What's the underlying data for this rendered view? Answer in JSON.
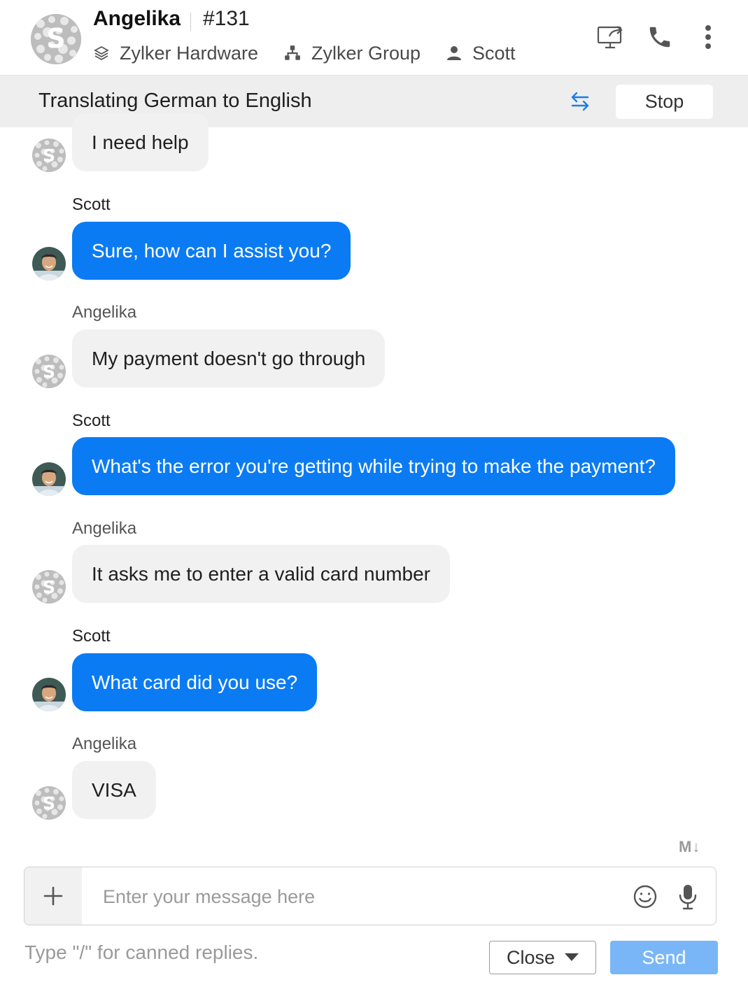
{
  "header": {
    "contact_name": "Angelika",
    "ticket_id": "#131",
    "brand": "Zylker Hardware",
    "department": "Zylker Group",
    "agent": "Scott"
  },
  "translation": {
    "label": "Translating German to English",
    "stop_label": "Stop"
  },
  "messages": [
    {
      "sender": "",
      "text": "I need help",
      "direction": "in"
    },
    {
      "sender": "Scott",
      "text": "Sure, how can I assist you?",
      "direction": "out"
    },
    {
      "sender": "Angelika",
      "text": "My payment doesn't go through",
      "direction": "in"
    },
    {
      "sender": "Scott",
      "text": "What's the error you're getting while trying to make the payment?",
      "direction": "out"
    },
    {
      "sender": "Angelika",
      "text": "It asks me to enter a valid card number",
      "direction": "in"
    },
    {
      "sender": "Scott",
      "text": "What card did you use?",
      "direction": "out"
    },
    {
      "sender": "Angelika",
      "text": "VISA",
      "direction": "in"
    }
  ],
  "composer": {
    "markdown_label": "M↓",
    "placeholder": "Enter your message here",
    "hint": "Type \"/\" for canned replies.",
    "close_label": "Close",
    "send_label": "Send"
  },
  "colors": {
    "agent_bubble": "#0b7bf3",
    "customer_bubble": "#f1f1f1",
    "send_button": "#79b6f7",
    "swap_icon": "#1a7fe8"
  },
  "icons": [
    "screen-share-icon",
    "phone-icon",
    "more-vertical-icon",
    "brand-stack-icon",
    "department-icon",
    "agent-person-icon",
    "swap-arrows-icon",
    "plus-icon",
    "emoji-icon",
    "microphone-icon",
    "caret-down-icon",
    "markdown-icon"
  ]
}
